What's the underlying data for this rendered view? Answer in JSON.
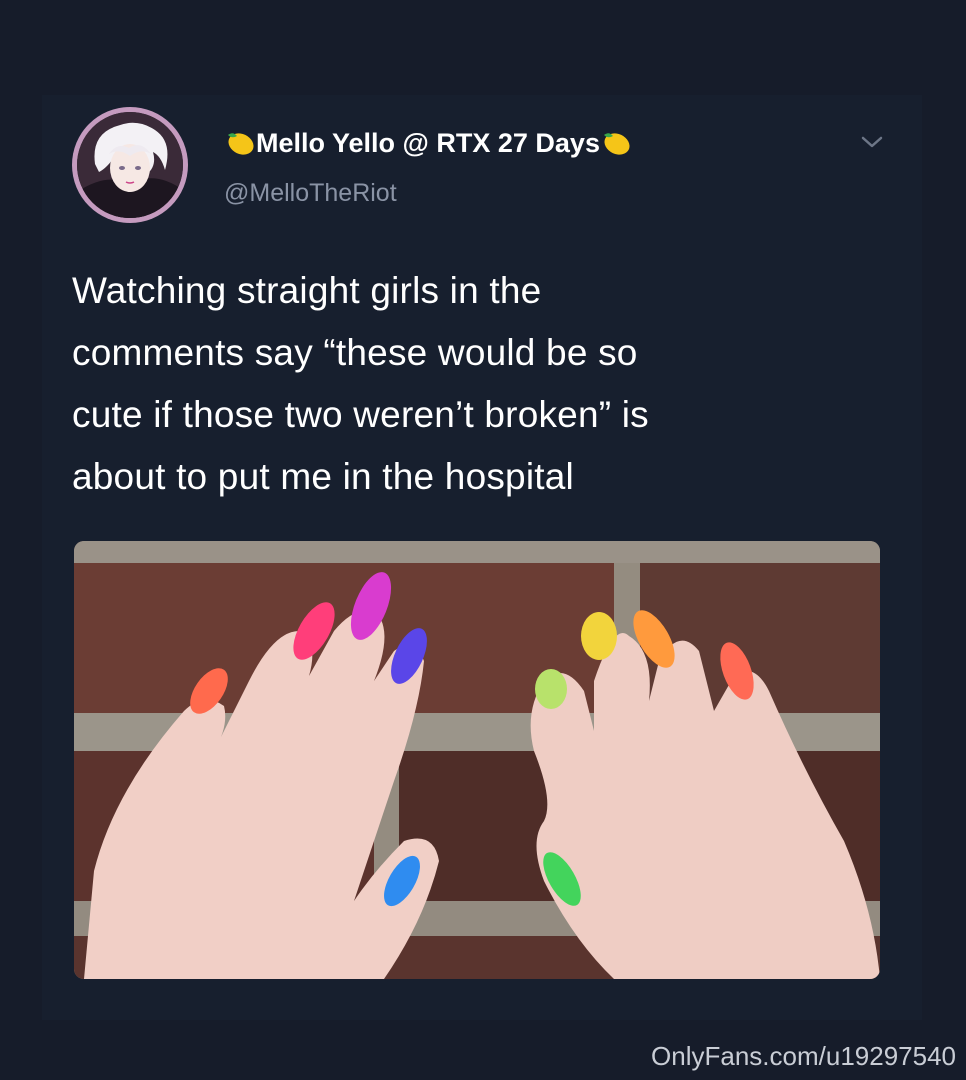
{
  "tweet": {
    "display_name": "Mello Yello @ RTX 27 Days",
    "handle": "@MelloTheRiot",
    "lines": [
      "Watching straight girls in the",
      "comments say “these would be so",
      "cute if those two weren’t broken” is",
      "about to put me in the hospital"
    ],
    "name_emoji": "lemon-icon",
    "menu_icon": "chevron-down-icon",
    "image": {
      "subject": "two hands with rainbow-painted stiletto nails on a brick wall",
      "nail_colors": [
        "#ff6a4d",
        "#ff3e7a",
        "#d93ccf",
        "#5a46e8",
        "#2f8cf0",
        "#b8e26b",
        "#f2d43c",
        "#ff9a3d",
        "#ff6a55",
        "#43d45c"
      ]
    }
  },
  "watermark": "OnlyFans.com/u19297540",
  "colors": {
    "background": "#161c2a",
    "text_primary": "#ffffff",
    "text_secondary": "#8a93a5",
    "avatar_ring": "#c59bbf"
  }
}
